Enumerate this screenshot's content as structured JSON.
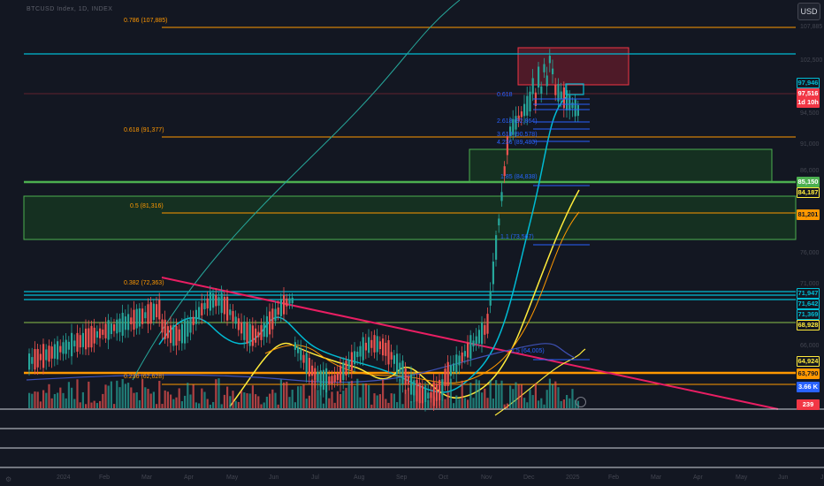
{
  "header": {
    "symbol": "BTCUSD Index, 1D, INDEX",
    "currency_button": "USD"
  },
  "fib_levels": [
    {
      "label": "0.786 (107,885)",
      "color": "#ff9800"
    },
    {
      "label": "0.618 (91,377)",
      "color": "#ff9800"
    },
    {
      "label": "0.5 (81,316)",
      "color": "#ff9800"
    },
    {
      "label": "0.382 (72,363)",
      "color": "#ff9800"
    },
    {
      "label": "0.236 (62,628)",
      "color": "#ff9800"
    }
  ],
  "fib_ext_labels": [
    "0.618",
    "2.618 (92,864)",
    "3.618 (90,578)",
    "4.236 (89,480)",
    "1.85 (84,838)",
    "1.1 (73,567)",
    "1.5 (64,005)"
  ],
  "price_tags": [
    {
      "text": "97,946",
      "bg": "#131722",
      "fg": "#00bcd4",
      "border": "#00bcd4"
    },
    {
      "text": "97,516",
      "bg": "#f23645",
      "fg": "#ffffff",
      "border": "#f23645"
    },
    {
      "text": "1d 10h",
      "bg": "#f23645",
      "fg": "#ffffff",
      "border": "#f23645"
    },
    {
      "text": "85,150",
      "bg": "#4caf50",
      "fg": "#ffffff",
      "border": "#4caf50"
    },
    {
      "text": "84,187",
      "bg": "#131722",
      "fg": "#ffeb3b",
      "border": "#ffeb3b"
    },
    {
      "text": "81,201",
      "bg": "#ff9800",
      "fg": "#131722",
      "border": "#ff9800"
    },
    {
      "text": "71,947",
      "bg": "#131722",
      "fg": "#00bcd4",
      "border": "#00bcd4"
    },
    {
      "text": "71,642",
      "bg": "#131722",
      "fg": "#00bcd4",
      "border": "#00bcd4"
    },
    {
      "text": "71,369",
      "bg": "#131722",
      "fg": "#00bcd4",
      "border": "#00bcd4"
    },
    {
      "text": "68,928",
      "bg": "#131722",
      "fg": "#ffeb3b",
      "border": "#ffeb3b"
    },
    {
      "text": "64,924",
      "bg": "#131722",
      "fg": "#ffeb3b",
      "border": "#ffeb3b"
    },
    {
      "text": "63,790",
      "bg": "#ff9800",
      "fg": "#131722",
      "border": "#ff9800"
    },
    {
      "text": "3.66 K",
      "bg": "#2962ff",
      "fg": "#ffffff",
      "border": "#2962ff"
    },
    {
      "text": "239",
      "bg": "#f23645",
      "fg": "#ffffff",
      "border": "#f23645"
    }
  ],
  "axis_ticks": [
    "107,885",
    "102,500",
    "94,500",
    "91,000",
    "86,000",
    "76,000",
    "71,000",
    "66,000"
  ],
  "time_axis": [
    "2024",
    "Feb",
    "Mar",
    "Apr",
    "May",
    "Jun",
    "Jul",
    "Aug",
    "Sep",
    "Oct",
    "Nov",
    "Dec",
    "2025",
    "Feb",
    "Mar",
    "Apr",
    "May",
    "Jun",
    "Jul"
  ],
  "colors": {
    "background": "#131722",
    "up": "#26a69a",
    "down": "#ef5350",
    "cyan": "#00bcd4",
    "orange": "#ff9800",
    "green": "#4caf50",
    "yellow": "#ffeb3b",
    "pink": "#e91e63"
  }
}
